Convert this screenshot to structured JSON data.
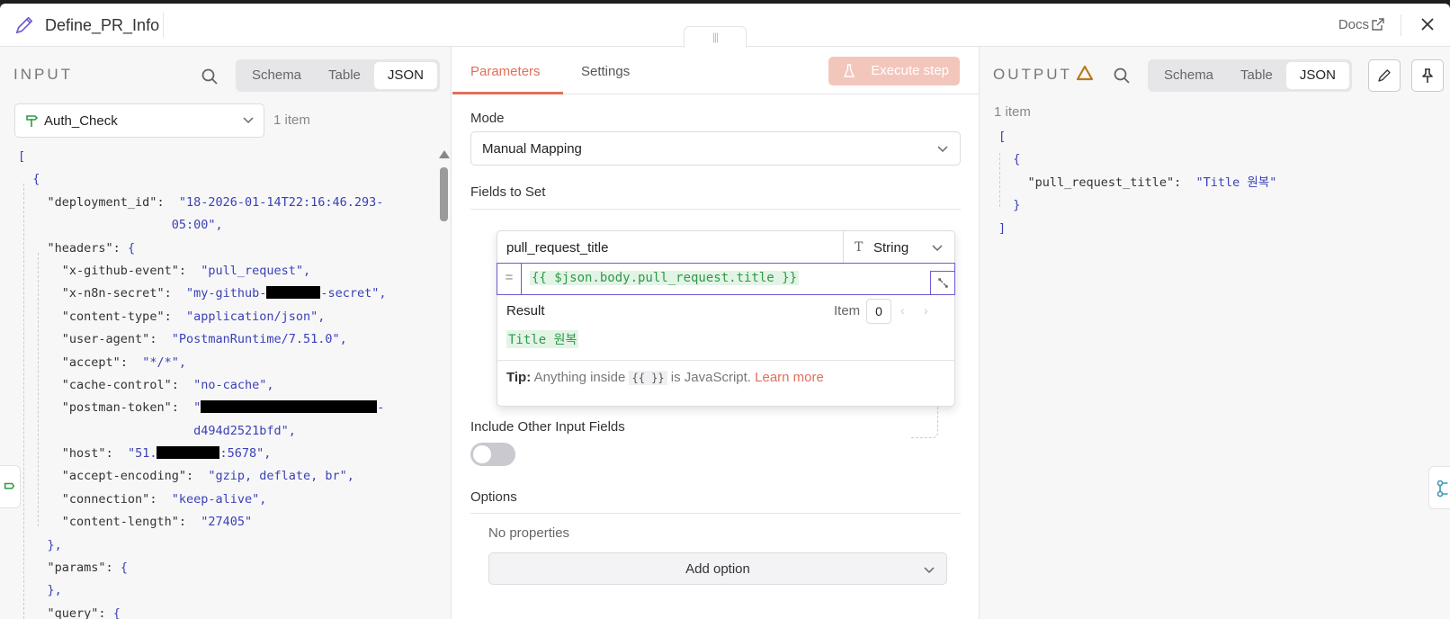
{
  "header": {
    "node_title": "Define_PR_Info",
    "docs_label": "Docs"
  },
  "input": {
    "label": "INPUT",
    "tabs": [
      "Schema",
      "Table",
      "JSON"
    ],
    "active_tab": "JSON",
    "node_selected": "Auth_Check",
    "item_count": "1 item"
  },
  "params": {
    "tabs": [
      "Parameters",
      "Settings"
    ],
    "execute_label": "Execute step",
    "mode_label": "Mode",
    "mode_value": "Manual Mapping",
    "fields_label": "Fields to Set",
    "field_name": "pull_request_title",
    "field_type": "String",
    "expression": "{{ $json.body.pull_request.title }}",
    "result_label": "Result",
    "item_label": "Item",
    "item_index": "0",
    "result_value": "Title 원복",
    "tip_label": "Tip:",
    "tip_text_1": "Anything inside",
    "tip_code": "{{ }}",
    "tip_text_2": "is JavaScript.",
    "tip_link": "Learn more",
    "include_label": "Include Other Input Fields",
    "include_enabled": false,
    "options_label": "Options",
    "no_props": "No properties",
    "add_option": "Add option"
  },
  "output": {
    "label": "OUTPUT",
    "tabs": [
      "Schema",
      "Table",
      "JSON"
    ],
    "active_tab": "JSON",
    "item_count": "1 item",
    "json_key": "\"pull_request_title\"",
    "json_value": "\"Title 원복\""
  },
  "json_lines": {
    "l1": "[",
    "l2": "{",
    "deployment_key": "\"deployment_id\"",
    "deployment_v1": "\"18-2026-01-14T22:16:46.293-",
    "deployment_v2": "05:00\"",
    "headers_key": "\"headers\"",
    "xge_key": "\"x-github-event\"",
    "xge_val": "\"pull_request\"",
    "xns_key": "\"x-n8n-secret\"",
    "xns_val_a": "\"my-github-",
    "xns_val_b": "-secret\"",
    "ct_key": "\"content-type\"",
    "ct_val": "\"application/json\"",
    "ua_key": "\"user-agent\"",
    "ua_val": "\"PostmanRuntime/7.51.0\"",
    "acc_key": "\"accept\"",
    "acc_val": "\"*/*\"",
    "cc_key": "\"cache-control\"",
    "cc_val": "\"no-cache\"",
    "pt_key": "\"postman-token\"",
    "pt_val_a": "\"",
    "pt_val_b": "-",
    "pt_val_2": "d494d2521bfd\"",
    "host_key": "\"host\"",
    "host_val_a": "\"51.",
    "host_val_b": ":5678\"",
    "ae_key": "\"accept-encoding\"",
    "ae_val": "\"gzip, deflate, br\"",
    "conn_key": "\"connection\"",
    "conn_val": "\"keep-alive\"",
    "cl_key": "\"content-length\"",
    "cl_val": "\"27405\"",
    "params_key": "\"params\"",
    "query_key": "\"query\""
  },
  "colors": {
    "accent": "#e0705a",
    "expression_green": "#2e9a48",
    "json_value_blue": "#3b41b5",
    "expression_border": "#6b5bd6",
    "warning": "#b7791f"
  }
}
